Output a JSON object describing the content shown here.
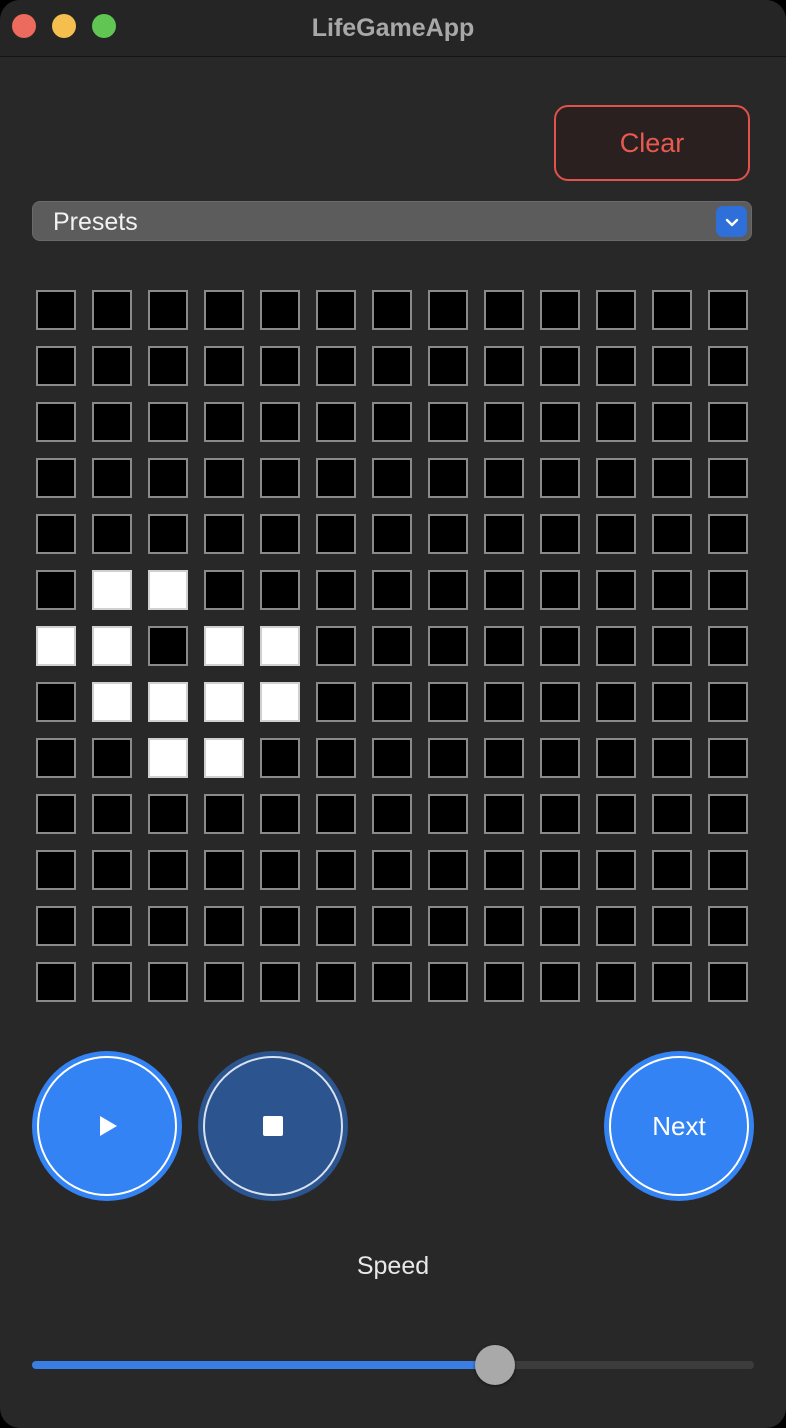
{
  "window": {
    "title": "LifeGameApp",
    "traffic_colors": {
      "close": "#ec6a5e",
      "minimize": "#f4bf4f",
      "zoom": "#61c554"
    }
  },
  "toolbar": {
    "clear_label": "Clear"
  },
  "presets": {
    "label": "Presets",
    "icon": "chevron-down-icon"
  },
  "grid": {
    "rows": 13,
    "cols": 13,
    "alive": [
      [
        5,
        1
      ],
      [
        5,
        2
      ],
      [
        6,
        0
      ],
      [
        6,
        1
      ],
      [
        6,
        3
      ],
      [
        6,
        4
      ],
      [
        7,
        1
      ],
      [
        7,
        2
      ],
      [
        7,
        3
      ],
      [
        7,
        4
      ],
      [
        8,
        2
      ],
      [
        8,
        3
      ]
    ]
  },
  "controls": {
    "play_icon": "play-icon",
    "stop_icon": "stop-icon",
    "next_label": "Next"
  },
  "speed": {
    "label": "Speed",
    "value": 0.65
  }
}
